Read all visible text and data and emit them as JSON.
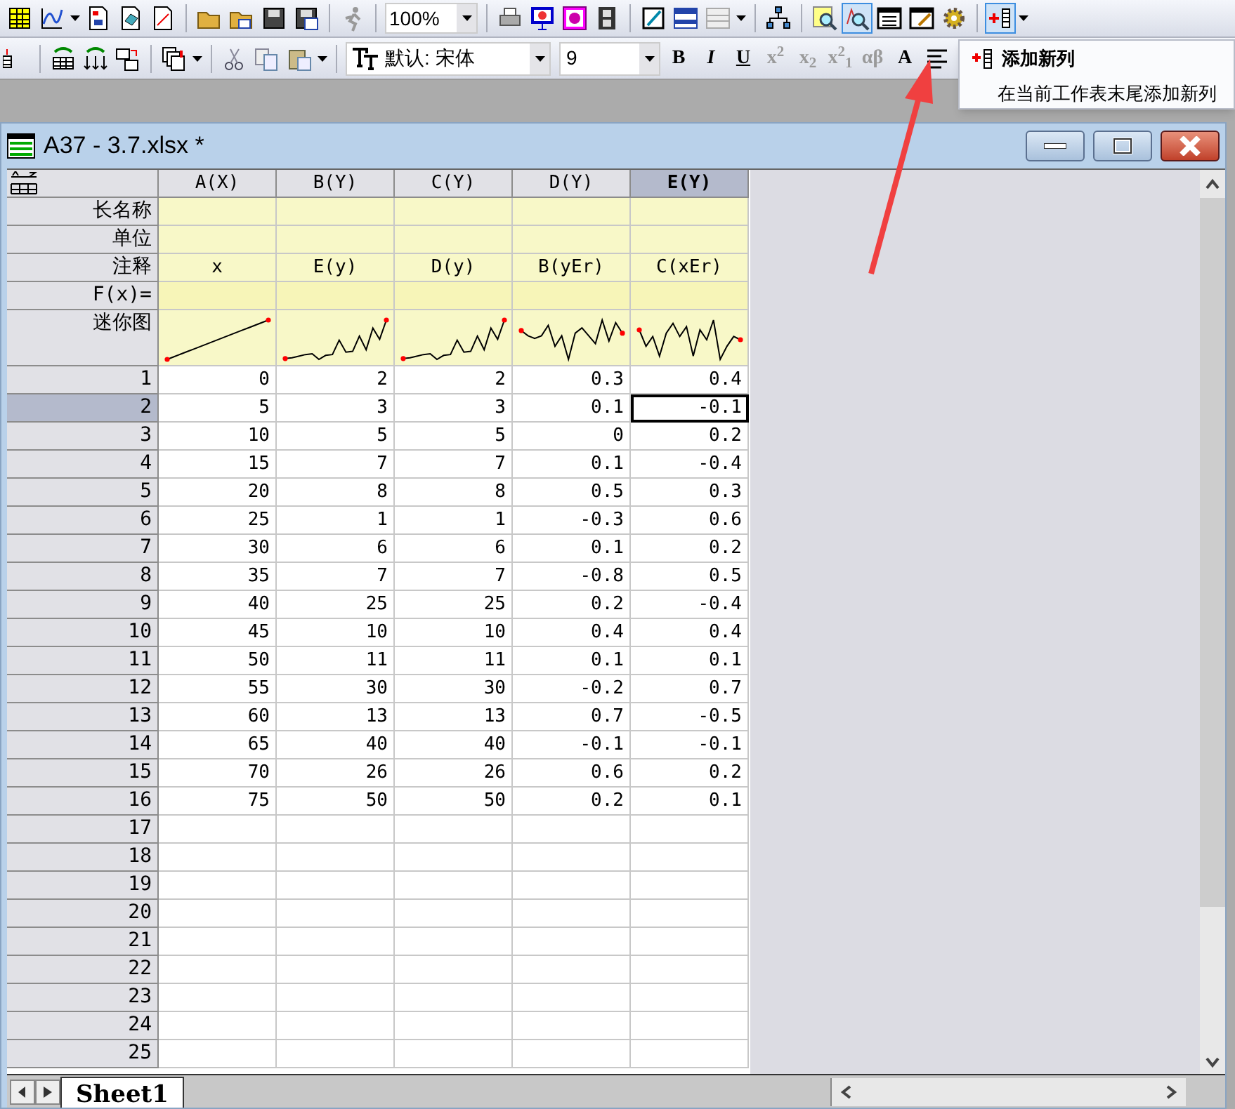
{
  "toolbar": {
    "zoom": "100%",
    "font": "默认: 宋体",
    "font_size": "9",
    "format_buttons": [
      {
        "label": "B",
        "disabled": false,
        "kind": "bold"
      },
      {
        "label": "I",
        "disabled": false,
        "kind": "italic"
      },
      {
        "label": "U",
        "disabled": false,
        "kind": "underline"
      },
      {
        "label": "x$^{2}$",
        "disabled": true,
        "kind": "plain"
      },
      {
        "label": "x$_{2}$",
        "disabled": true,
        "kind": "plain"
      },
      {
        "label": "x$^{2}$$_{1}$",
        "disabled": true,
        "kind": "plain"
      },
      {
        "label": "αβ",
        "disabled": true,
        "kind": "plain"
      },
      {
        "label": "A",
        "disabled": false,
        "kind": "plain"
      }
    ]
  },
  "tooltip": {
    "title": "添加新列",
    "description": "在当前工作表末尾添加新列"
  },
  "window": {
    "title": "A37 - 3.7.xlsx *"
  },
  "sheet": {
    "label_rows": [
      {
        "label": "长名称",
        "kind": "text"
      },
      {
        "label": "单位",
        "kind": "text"
      },
      {
        "label": "注释",
        "kind": "text"
      },
      {
        "label": "F(x)=",
        "kind": "formula"
      },
      {
        "label": "迷你图",
        "kind": "sparkline"
      }
    ],
    "columns": [
      {
        "header": "A(X)",
        "selected": false,
        "comment": "x"
      },
      {
        "header": "B(Y)",
        "selected": false,
        "comment": "E(y)"
      },
      {
        "header": "C(Y)",
        "selected": false,
        "comment": "D(y)"
      },
      {
        "header": "D(Y)",
        "selected": false,
        "comment": "B(yEr)"
      },
      {
        "header": "E(Y)",
        "selected": true,
        "comment": "C(xEr)"
      }
    ],
    "rows": [
      {
        "label": "1",
        "selected": false,
        "cells": [
          "0",
          "2",
          "2",
          "0.3",
          "0.4"
        ]
      },
      {
        "label": "2",
        "selected": true,
        "cells": [
          "5",
          "3",
          "3",
          "0.1",
          "-0.1"
        ]
      },
      {
        "label": "3",
        "selected": false,
        "cells": [
          "10",
          "5",
          "5",
          "0",
          "0.2"
        ]
      },
      {
        "label": "4",
        "selected": false,
        "cells": [
          "15",
          "7",
          "7",
          "0.1",
          "-0.4"
        ]
      },
      {
        "label": "5",
        "selected": false,
        "cells": [
          "20",
          "8",
          "8",
          "0.5",
          "0.3"
        ]
      },
      {
        "label": "6",
        "selected": false,
        "cells": [
          "25",
          "1",
          "1",
          "-0.3",
          "0.6"
        ]
      },
      {
        "label": "7",
        "selected": false,
        "cells": [
          "30",
          "6",
          "6",
          "0.1",
          "0.2"
        ]
      },
      {
        "label": "8",
        "selected": false,
        "cells": [
          "35",
          "7",
          "7",
          "-0.8",
          "0.5"
        ]
      },
      {
        "label": "9",
        "selected": false,
        "cells": [
          "40",
          "25",
          "25",
          "0.2",
          "-0.4"
        ]
      },
      {
        "label": "10",
        "selected": false,
        "cells": [
          "45",
          "10",
          "10",
          "0.4",
          "0.4"
        ]
      },
      {
        "label": "11",
        "selected": false,
        "cells": [
          "50",
          "11",
          "11",
          "0.1",
          "0.1"
        ]
      },
      {
        "label": "12",
        "selected": false,
        "cells": [
          "55",
          "30",
          "30",
          "-0.2",
          "0.7"
        ]
      },
      {
        "label": "13",
        "selected": false,
        "cells": [
          "60",
          "13",
          "13",
          "0.7",
          "-0.5"
        ]
      },
      {
        "label": "14",
        "selected": false,
        "cells": [
          "65",
          "40",
          "40",
          "-0.1",
          "-0.1"
        ]
      },
      {
        "label": "15",
        "selected": false,
        "cells": [
          "70",
          "26",
          "26",
          "0.6",
          "0.2"
        ]
      },
      {
        "label": "16",
        "selected": false,
        "cells": [
          "75",
          "50",
          "50",
          "0.2",
          "0.1"
        ]
      },
      {
        "label": "17",
        "selected": false
      },
      {
        "label": "18",
        "selected": false
      },
      {
        "label": "19",
        "selected": false
      },
      {
        "label": "20",
        "selected": false
      },
      {
        "label": "21",
        "selected": false
      },
      {
        "label": "22",
        "selected": false
      },
      {
        "label": "23",
        "selected": false
      },
      {
        "label": "24",
        "selected": false
      },
      {
        "label": "25",
        "selected": false
      }
    ],
    "tabs": [
      {
        "label": "Sheet1",
        "selected": true
      }
    ]
  }
}
